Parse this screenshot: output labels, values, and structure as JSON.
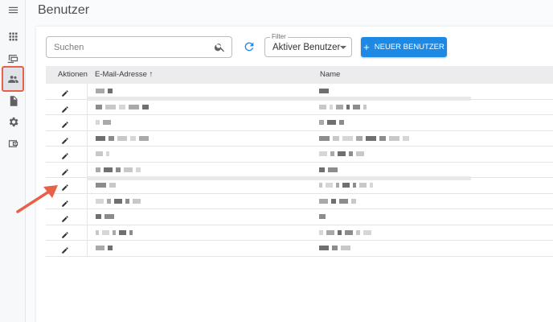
{
  "nav": {
    "items": [
      {
        "name": "menu-icon"
      },
      {
        "name": "apps-grid-icon"
      },
      {
        "name": "devices-icon"
      },
      {
        "name": "users-icon",
        "active": true
      },
      {
        "name": "document-icon"
      },
      {
        "name": "settings-gear-icon"
      },
      {
        "name": "wallet-icon"
      }
    ]
  },
  "header": {
    "title": "Benutzer"
  },
  "toolbar": {
    "search_placeholder": "Suchen",
    "filter_label": "Filter",
    "filter_value": "Aktiver Benutzer",
    "new_user_label": "NEUER BENUTZER"
  },
  "table": {
    "columns": {
      "actions": "Aktionen",
      "email": "E-Mail-Adresse",
      "email_sort": "↑",
      "name": "Name"
    },
    "row_count": 11
  },
  "colors": {
    "accent": "#1e88e5",
    "highlight": "#e9604a"
  }
}
